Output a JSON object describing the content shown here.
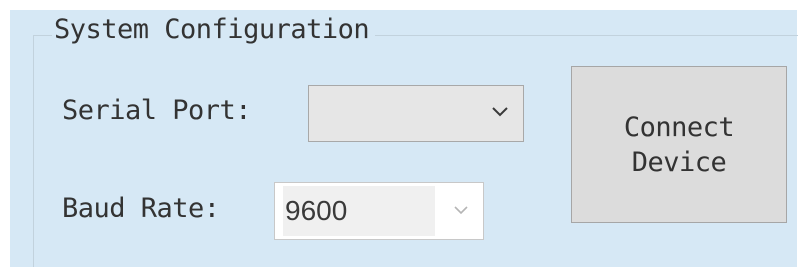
{
  "groupbox": {
    "title": "System Configuration"
  },
  "serial_port": {
    "label": "Serial Port:",
    "value": ""
  },
  "baud_rate": {
    "label": "Baud Rate:",
    "value": "9600"
  },
  "connect_button": {
    "line1": "Connect",
    "line2": "Device"
  },
  "icons": {
    "dropdown": "chevron-down-icon"
  }
}
